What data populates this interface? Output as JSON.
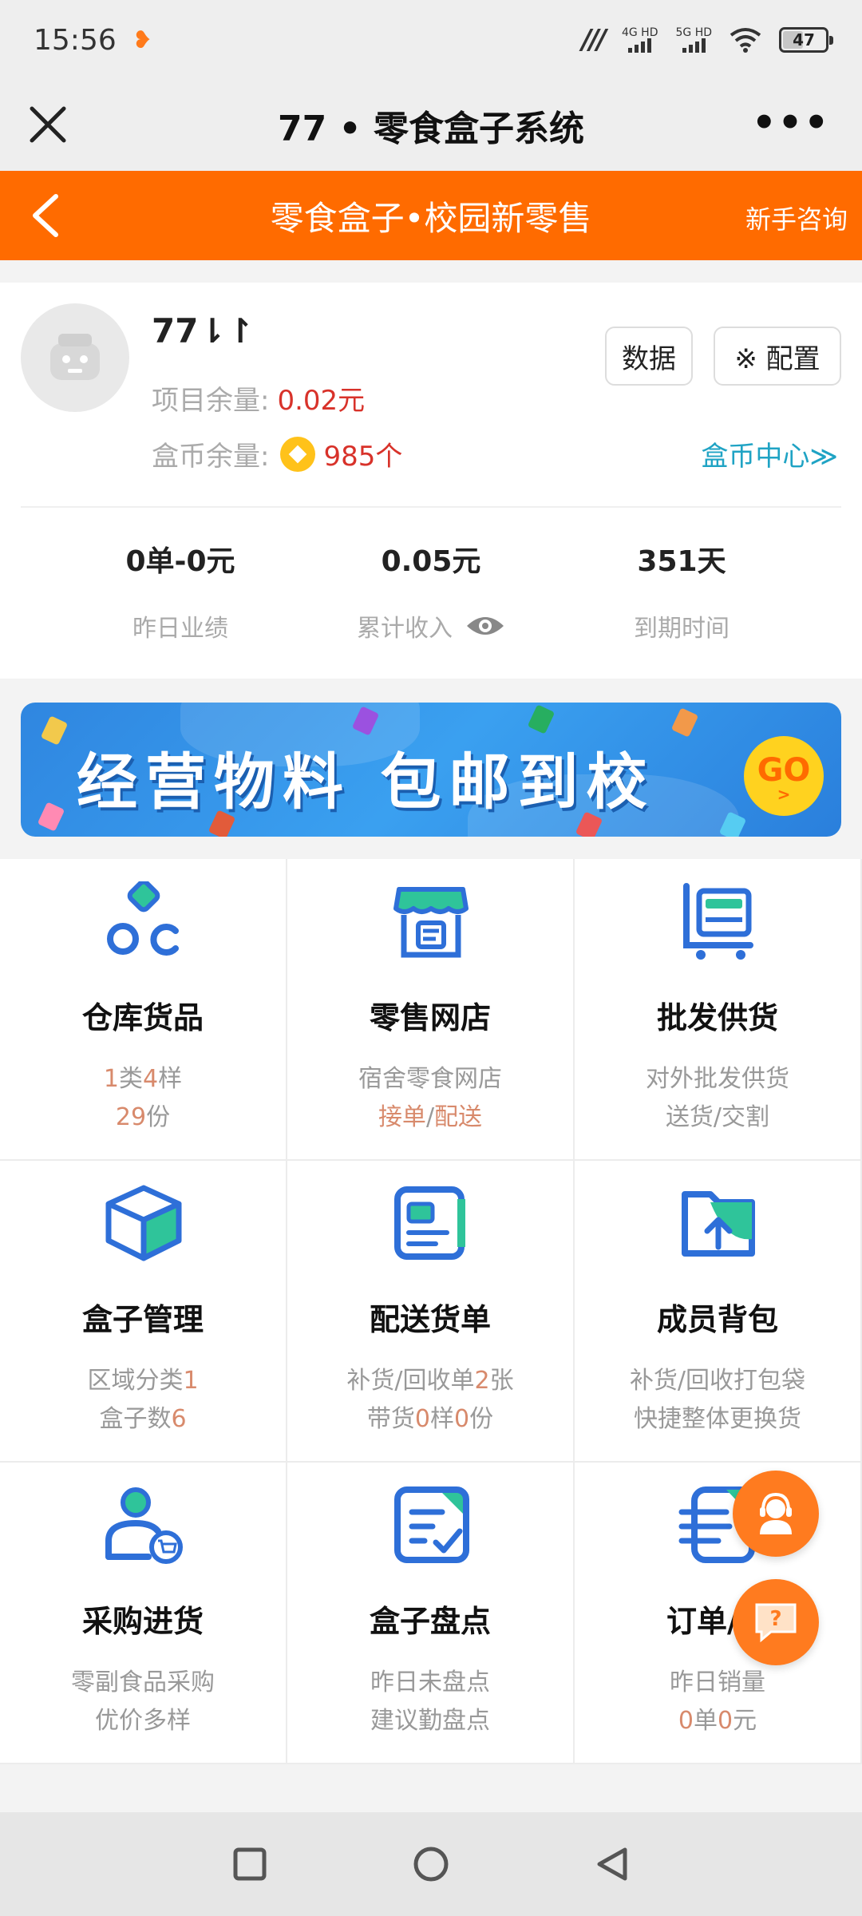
{
  "status_bar": {
    "time": "15:56",
    "net1": "4G HD",
    "net2": "5G HD",
    "battery": "47"
  },
  "title_bar": {
    "title": "77 • 零食盒子系统"
  },
  "header": {
    "title": "零食盒子•校园新零售",
    "consult_label": "新手咨询"
  },
  "profile": {
    "name": "77⇂↾",
    "project_balance_label": "项目余量:",
    "project_balance_value": "0.02元",
    "coin_balance_label": "盒币余量:",
    "coin_balance_value": "985个",
    "data_button": "数据",
    "config_button": "※ 配置",
    "coin_center_link": "盒币中心≫",
    "stats": [
      {
        "value": "0单-0元",
        "label": "昨日业绩"
      },
      {
        "value": "0.05元",
        "label": "累计收入"
      },
      {
        "value": "351天",
        "label": "到期时间"
      }
    ]
  },
  "banner": {
    "text": "经营物料  包邮到校",
    "go_label": "GO"
  },
  "grid": [
    {
      "name": "仓库货品",
      "icon": "warehouse-icon",
      "d1": [
        {
          "t": "1",
          "h": true
        },
        {
          "t": "类",
          "h": false
        },
        {
          "t": "4",
          "h": true
        },
        {
          "t": "样",
          "h": false
        }
      ],
      "d2": [
        {
          "t": "29",
          "h": true
        },
        {
          "t": "份",
          "h": false
        }
      ]
    },
    {
      "name": "零售网店",
      "icon": "shop-icon",
      "d1": [
        {
          "t": "宿舍零食网店",
          "h": false
        }
      ],
      "d2": [
        {
          "t": "接单",
          "h": true
        },
        {
          "t": "/",
          "h": false
        },
        {
          "t": "配送",
          "h": true
        }
      ]
    },
    {
      "name": "批发供货",
      "icon": "cart-icon",
      "d1": [
        {
          "t": "对外批发供货",
          "h": false
        }
      ],
      "d2": [
        {
          "t": "送货/交割",
          "h": false
        }
      ]
    },
    {
      "name": "盒子管理",
      "icon": "box-icon",
      "d1": [
        {
          "t": "区域分类",
          "h": false
        },
        {
          "t": "1",
          "h": true
        }
      ],
      "d2": [
        {
          "t": "盒子数",
          "h": false
        },
        {
          "t": "6",
          "h": true
        }
      ]
    },
    {
      "name": "配送货单",
      "icon": "delivery-list-icon",
      "d1": [
        {
          "t": "补货/回收单",
          "h": false
        },
        {
          "t": "2",
          "h": true
        },
        {
          "t": "张",
          "h": false
        }
      ],
      "d2": [
        {
          "t": "带货",
          "h": false
        },
        {
          "t": "0",
          "h": true
        },
        {
          "t": "样",
          "h": false
        },
        {
          "t": "0",
          "h": true
        },
        {
          "t": "份",
          "h": false
        }
      ]
    },
    {
      "name": "成员背包",
      "icon": "folder-upload-icon",
      "d1": [
        {
          "t": "补货/回收打包袋",
          "h": false
        }
      ],
      "d2": [
        {
          "t": "快捷整体更换货",
          "h": false
        }
      ]
    },
    {
      "name": "采购进货",
      "icon": "purchase-user-icon",
      "d1": [
        {
          "t": "零副食品采购",
          "h": false
        }
      ],
      "d2": [
        {
          "t": "优价多样",
          "h": false
        }
      ]
    },
    {
      "name": "盒子盘点",
      "icon": "checklist-icon",
      "d1": [
        {
          "t": "昨日未盘点",
          "h": false
        }
      ],
      "d2": [
        {
          "t": "建议勤盘点",
          "h": false
        }
      ]
    },
    {
      "name": "订单/资",
      "icon": "orders-icon",
      "d1": [
        {
          "t": "昨日销量",
          "h": false
        }
      ],
      "d2": [
        {
          "t": "0",
          "h": true
        },
        {
          "t": "单",
          "h": false
        },
        {
          "t": "0",
          "h": true
        },
        {
          "t": "元",
          "h": false
        }
      ]
    }
  ],
  "fab": {
    "support_icon": "customer-service-icon",
    "help_icon": "help-chat-icon",
    "help_label": "?"
  },
  "colors": {
    "primary_orange": "#ff6b00",
    "icon_blue": "#2e6fd8",
    "icon_green": "#2fc49a",
    "highlight": "#d88a6c",
    "coin_link": "#1fa3c4",
    "red_value": "#d8322a"
  }
}
